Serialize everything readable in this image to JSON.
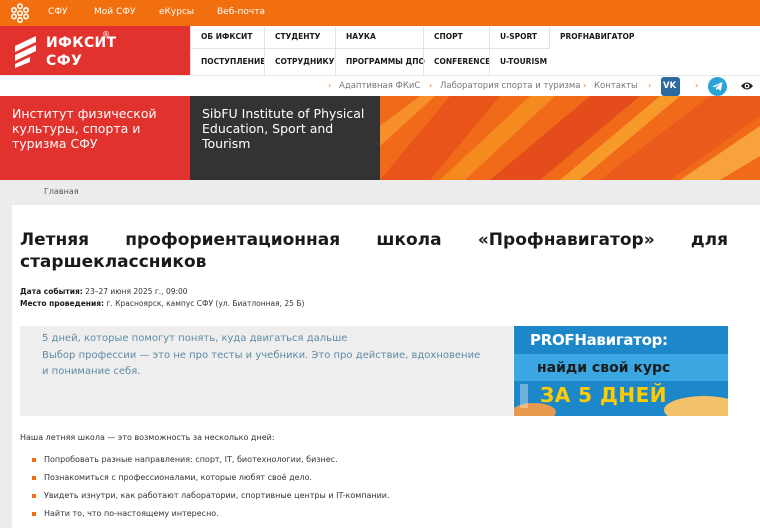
{
  "topbar": {
    "links": [
      "СФУ",
      "Мой СФУ",
      "еКурсы",
      "Веб-почта"
    ],
    "bg_color": "#f26f0f"
  },
  "logo": {
    "line1": "ИФКСИТ",
    "line2": "СФУ",
    "reg": "®"
  },
  "mainnav": {
    "row1": [
      "ОБ ИФКСИТ",
      "СТУДЕНТУ",
      "НАУКА",
      "СПОРТ",
      "U-SPORT",
      "PROFНАВИГАТОР"
    ],
    "row2": [
      "ПОСТУПЛЕНИЕ",
      "СОТРУДНИКУ",
      "ПРОГРАММЫ ДПО",
      "CONFERENCE",
      "U-TOURISM"
    ]
  },
  "subnav": {
    "links": [
      "Адаптивная ФКиС",
      "Лаборатория спорта и туризма",
      "Контакты"
    ],
    "vk_label": "VK"
  },
  "hero": {
    "ru_title": "Институт физической культуры, спорта и туризма СФУ",
    "en_title": "SibFU Institute of Physical Education, Sport and Tourism"
  },
  "breadcrumb": "Главная",
  "article": {
    "title": "Летняя профориентационная школа «Профнавигатор» для старшеклассников",
    "date_label": "Дата события:",
    "date_value": " 23–27 июня 2025 г., 09:00",
    "place_label": "Место проведения:",
    "place_value": " г. Красноярск, кампус СФУ (ул. Биатлонная, 25 Б)",
    "quote_lines": [
      "5 дней, которые помогут понять, куда двигаться дальше",
      "Выбор профессии — это не про тесты и учебники. Это про действие, вдохновение",
      "и понимание себя."
    ],
    "promo": {
      "line1": "PROFНавигатор:",
      "line2": "найди свой курс",
      "line3": "ЗА 5 ДНЕЙ"
    },
    "intro": "Наша летняя школа — это возможность за несколько дней:",
    "items": [
      "Попробовать разные направления: спорт, IT, биотехнологии, бизнес.",
      "Познакомиться с профессионалами, которые любят своё дело.",
      "Увидеть изнутри, как работают лаборатории, спортивные центры и IT-компании.",
      "Найти то, что по-настоящему интересно."
    ]
  }
}
